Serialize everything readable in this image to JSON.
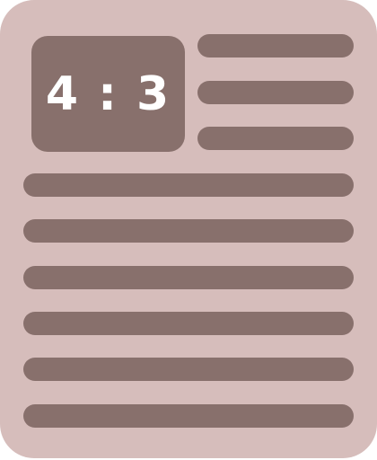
{
  "ratio_label": "4 : 3",
  "colors": {
    "page": "#d6bdbb",
    "ink": "#88706c",
    "text": "#ffffff"
  }
}
